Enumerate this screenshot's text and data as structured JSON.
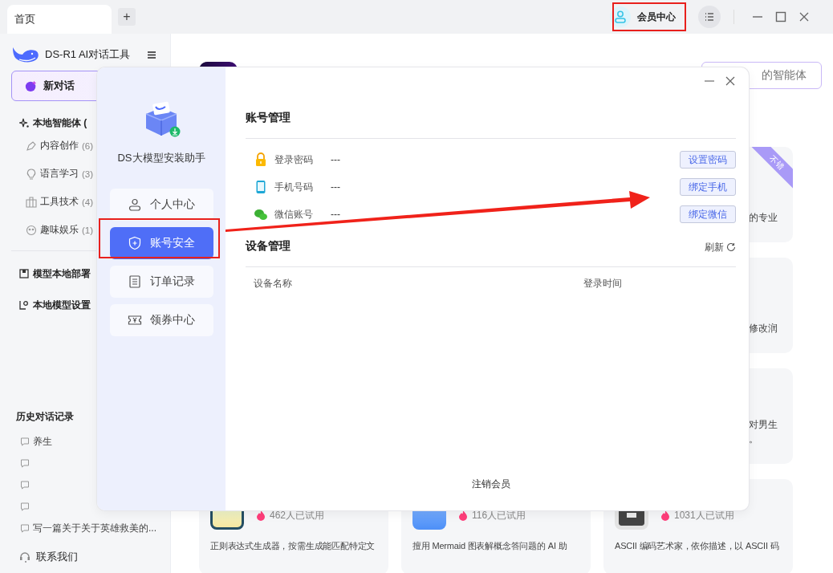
{
  "tabs": [
    {
      "label": "首页",
      "selected": true
    }
  ],
  "new_tab": "+",
  "title_bar": {
    "member_center": "会员中心"
  },
  "sidebar": {
    "app_name": "DS-R1 AI对话工具",
    "new_chat": "新对话",
    "groups": [
      {
        "label": "本地智能体 (",
        "children": [
          {
            "kind": "pen",
            "label": "内容创作",
            "count": "(6)"
          },
          {
            "kind": "bulb",
            "label": "语言学习",
            "count": "(3)"
          },
          {
            "kind": "toolbox",
            "label": "工具技术",
            "count": "(4)"
          },
          {
            "kind": "fun",
            "label": "趣味娱乐",
            "count": "(1)"
          }
        ]
      },
      {
        "label": "模型本地部署"
      },
      {
        "label": "本地模型设置"
      }
    ],
    "history_title": "历史对话记录",
    "history": [
      {
        "kind": "titled",
        "title": "养生"
      },
      {
        "kind": "untitled"
      },
      {
        "kind": "untitled"
      },
      {
        "kind": "untitled"
      },
      {
        "kind": "titled",
        "title": "写一篇关于关于英雄救美的..."
      }
    ],
    "contact": "联系我们"
  },
  "main": {
    "agent_button": "的智能体",
    "side_cards": [
      {
        "ribbon": "不错",
        "lines": [
          "的专业"
        ]
      },
      {
        "lines": [
          "修改润"
        ]
      },
      {
        "lines": [
          "对男生",
          "。"
        ]
      }
    ],
    "bottom_cards": [
      {
        "kind": "regex",
        "users": "462人已试用",
        "description": "正则表达式生成器，按需生成能匹配特定文"
      },
      {
        "kind": "chart",
        "users": "116人已试用",
        "description": "擅用 Mermaid 图表解概念答问题的 AI 助"
      },
      {
        "kind": "ascii",
        "users": "1031人已试用",
        "description": "ASCII 编码艺术家，依你描述，以 ASCII 码"
      }
    ]
  },
  "modal": {
    "app_title": "DS大模型安装助手",
    "nav": [
      {
        "kind": "user",
        "label": "个人中心",
        "selected": false
      },
      {
        "kind": "shield",
        "label": "账号安全",
        "selected": true
      },
      {
        "kind": "list",
        "label": "订单记录",
        "selected": false
      },
      {
        "kind": "coupon",
        "label": "领券中心",
        "selected": false
      }
    ],
    "account_title": "账号管理",
    "accounts": [
      {
        "kind": "lock",
        "label": "登录密码",
        "value": "---",
        "action": "设置密码"
      },
      {
        "kind": "phone",
        "label": "手机号码",
        "value": "---",
        "action": "绑定手机"
      },
      {
        "kind": "wechat",
        "label": "微信账号",
        "value": "---",
        "action": "绑定微信"
      }
    ],
    "device_title": "设备管理",
    "refresh": "刷新",
    "columns": [
      "设备名称",
      "登录时间"
    ],
    "cancel": "注销会员"
  }
}
